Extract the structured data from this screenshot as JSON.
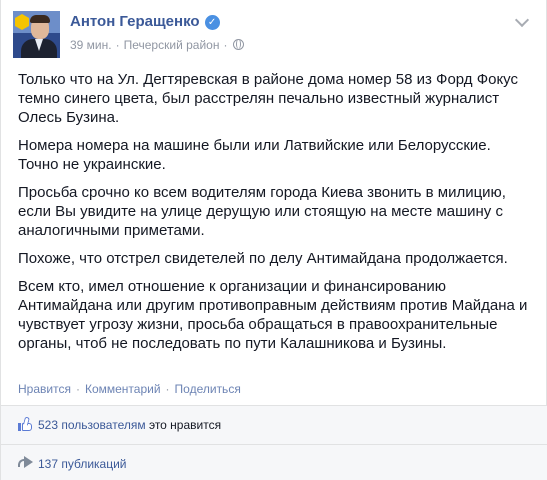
{
  "post": {
    "author": "Антон Геращенко",
    "time": "39 мин.",
    "separator": "·",
    "location": "Печерский район",
    "paragraphs": [
      "Только что на Ул. Дегтяревская в районе дома номер 58 из Форд Фокус темно синего цвета, был расстрелян печально известный журналист Олесь Бузина.",
      "Номера номера на машине были или Латвийские или Белорусские. Точно не украинские.",
      "Просьба срочно ко всем водителям города Киева звонить в милицию, если Вы увидите на улице дерущую или стоящую на месте машину с аналогичными приметами.",
      "Похоже, что отстрел свидетелей по делу Антимайдана продолжается.",
      "Всем кто, имел отношение к организации и финансированию Антимайдана или другим противоправным действиям против Майдана и чувствует угрозу жизни, просьба обращаться в правоохранительные органы, чтоб не последовать по пути Калашникова и Бузины."
    ],
    "actions": {
      "like": "Нравится",
      "comment": "Комментарий",
      "share": "Поделиться",
      "separator": "·"
    },
    "feedback": {
      "likes_link": "523 пользователям",
      "likes_suffix": "это нравится",
      "shares": "137 публикаций"
    }
  },
  "icons": [
    "verified-badge-icon",
    "globe-icon",
    "chevron-down-icon",
    "thumbs-up-icon",
    "share-arrow-icon"
  ],
  "colors": {
    "link": "#3b5998",
    "action_link": "#6d84b4",
    "meta": "#9197a3",
    "text": "#141823",
    "feedback_bg": "#f6f7f9"
  }
}
